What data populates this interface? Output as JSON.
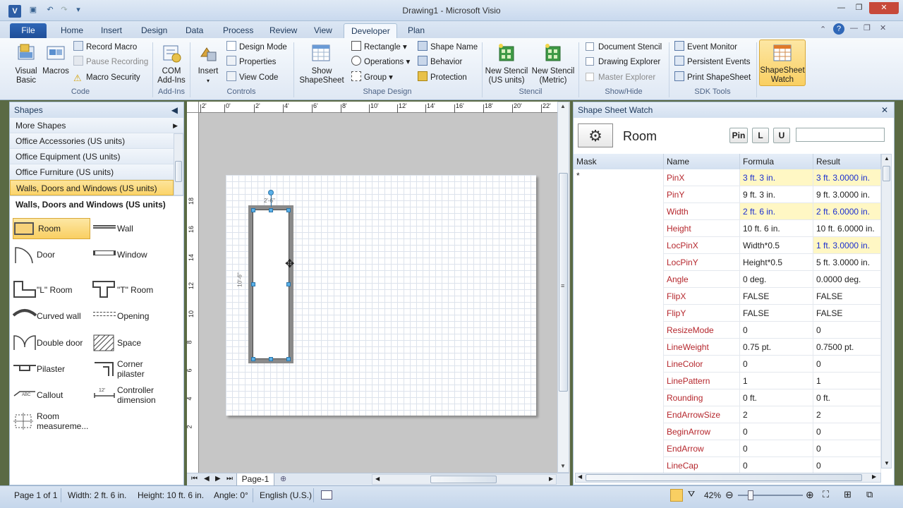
{
  "window": {
    "title": "Drawing1 - Microsoft Visio",
    "app_icon": "V",
    "min": "—",
    "restore": "❐",
    "close": "✕"
  },
  "tabs": [
    {
      "label": "File"
    },
    {
      "label": "Home"
    },
    {
      "label": "Insert"
    },
    {
      "label": "Design"
    },
    {
      "label": "Data"
    },
    {
      "label": "Process"
    },
    {
      "label": "Review"
    },
    {
      "label": "View"
    },
    {
      "label": "Developer"
    },
    {
      "label": "Plan"
    }
  ],
  "ribbon": {
    "code": {
      "group": "Code",
      "visual_basic": "Visual\nBasic",
      "macros": "Macros",
      "record_macro": "Record Macro",
      "pause_recording": "Pause Recording",
      "macro_security": "Macro Security"
    },
    "addins": {
      "group": "Add-Ins",
      "com": "COM\nAdd-Ins"
    },
    "controls": {
      "group": "Controls",
      "insert": "Insert",
      "design_mode": "Design Mode",
      "properties": "Properties",
      "view_code": "View Code"
    },
    "shape_design": {
      "group": "Shape Design",
      "show_shapesheet": "Show\nShapeSheet",
      "rectangle": "Rectangle",
      "operations": "Operations",
      "group_btn": "Group",
      "shape_name": "Shape Name",
      "behavior": "Behavior",
      "protection": "Protection"
    },
    "stencil": {
      "group": "Stencil",
      "new_us": "New Stencil\n(US units)",
      "new_metric": "New Stencil\n(Metric)"
    },
    "showhide": {
      "group": "Show/Hide",
      "document_stencil": "Document Stencil",
      "drawing_explorer": "Drawing Explorer",
      "master_explorer": "Master Explorer"
    },
    "sdk": {
      "group": "SDK Tools",
      "event_monitor": "Event Monitor",
      "persistent_events": "Persistent Events",
      "print_shapesheet": "Print ShapeSheet"
    },
    "watch": {
      "label": "ShapeSheet\nWatch"
    }
  },
  "shapes_panel": {
    "title": "Shapes",
    "more_shapes": "More Shapes",
    "stencils": [
      "Office Accessories (US units)",
      "Office Equipment (US units)",
      "Office Furniture (US units)",
      "Walls, Doors and Windows (US units)"
    ],
    "section_title": "Walls, Doors and Windows (US units)",
    "masters": [
      {
        "label": "Room"
      },
      {
        "label": "Wall"
      },
      {
        "label": "Door"
      },
      {
        "label": "Window"
      },
      {
        "label": "\"L\" Room"
      },
      {
        "label": "\"T\" Room"
      },
      {
        "label": "Curved wall"
      },
      {
        "label": "Opening"
      },
      {
        "label": "Double door"
      },
      {
        "label": "Space"
      },
      {
        "label": "Pilaster"
      },
      {
        "label": "Corner\npilaster"
      },
      {
        "label": "Callout"
      },
      {
        "label": "Controller\ndimension"
      },
      {
        "label": "Room\nmeasureme..."
      }
    ]
  },
  "ruler": {
    "h": [
      "2'",
      "0'",
      "2'",
      "4'",
      "6'",
      "8'",
      "10'",
      "12'",
      "14'",
      "16'",
      "18'",
      "20'",
      "22'"
    ],
    "v": [
      "18",
      "16",
      "14",
      "12",
      "10",
      "8",
      "6",
      "4",
      "2"
    ]
  },
  "drawing": {
    "dim_h": "2'-6\"",
    "dim_v": "10'-6\""
  },
  "page_tabs": {
    "current": "Page-1"
  },
  "watch": {
    "title": "Shape Sheet Watch",
    "shape_name": "Room",
    "pin": "Pin",
    "l": "L",
    "u": "U",
    "columns": [
      "Mask",
      "Name",
      "Formula",
      "Result"
    ],
    "mask_value": "*",
    "rows": [
      {
        "name": "PinX",
        "formula": "3 ft. 3 in.",
        "result": "3 ft. 3.0000 in.",
        "hf": true,
        "hr": true
      },
      {
        "name": "PinY",
        "formula": "9 ft. 3 in.",
        "result": "9 ft. 3.0000 in.",
        "hf": false,
        "hr": false
      },
      {
        "name": "Width",
        "formula": "2 ft. 6 in.",
        "result": "2 ft. 6.0000 in.",
        "hf": true,
        "hr": true
      },
      {
        "name": "Height",
        "formula": "10 ft. 6 in.",
        "result": "10 ft. 6.0000 in.",
        "hf": false,
        "hr": false
      },
      {
        "name": "LocPinX",
        "formula": "Width*0.5",
        "result": "1 ft. 3.0000 in.",
        "hf": false,
        "hr": true
      },
      {
        "name": "LocPinY",
        "formula": "Height*0.5",
        "result": "5 ft. 3.0000 in.",
        "hf": false,
        "hr": false
      },
      {
        "name": "Angle",
        "formula": "0 deg.",
        "result": "0.0000 deg.",
        "hf": false,
        "hr": false
      },
      {
        "name": "FlipX",
        "formula": "FALSE",
        "result": "FALSE",
        "hf": false,
        "hr": false
      },
      {
        "name": "FlipY",
        "formula": "FALSE",
        "result": "FALSE",
        "hf": false,
        "hr": false
      },
      {
        "name": "ResizeMode",
        "formula": "0",
        "result": "0",
        "hf": false,
        "hr": false
      },
      {
        "name": "LineWeight",
        "formula": "0.75 pt.",
        "result": "0.7500 pt.",
        "hf": false,
        "hr": false
      },
      {
        "name": "LineColor",
        "formula": "0",
        "result": "0",
        "hf": false,
        "hr": false
      },
      {
        "name": "LinePattern",
        "formula": "1",
        "result": "1",
        "hf": false,
        "hr": false
      },
      {
        "name": "Rounding",
        "formula": "0 ft.",
        "result": "0 ft.",
        "hf": false,
        "hr": false
      },
      {
        "name": "EndArrowSize",
        "formula": "2",
        "result": "2",
        "hf": false,
        "hr": false
      },
      {
        "name": "BeginArrow",
        "formula": "0",
        "result": "0",
        "hf": false,
        "hr": false
      },
      {
        "name": "EndArrow",
        "formula": "0",
        "result": "0",
        "hf": false,
        "hr": false
      },
      {
        "name": "LineCap",
        "formula": "0",
        "result": "0",
        "hf": false,
        "hr": false
      }
    ]
  },
  "status": {
    "page": "Page 1 of 1",
    "width": "Width: 2 ft. 6 in.",
    "height": "Height: 10 ft. 6 in.",
    "angle": "Angle: 0°",
    "language": "English (U.S.)",
    "zoom": "42%"
  },
  "colors": {
    "accent": "#2f67b7",
    "selection": "#fbd46a",
    "highlight": "#fff7c4",
    "cell_name": "#b5272d"
  }
}
